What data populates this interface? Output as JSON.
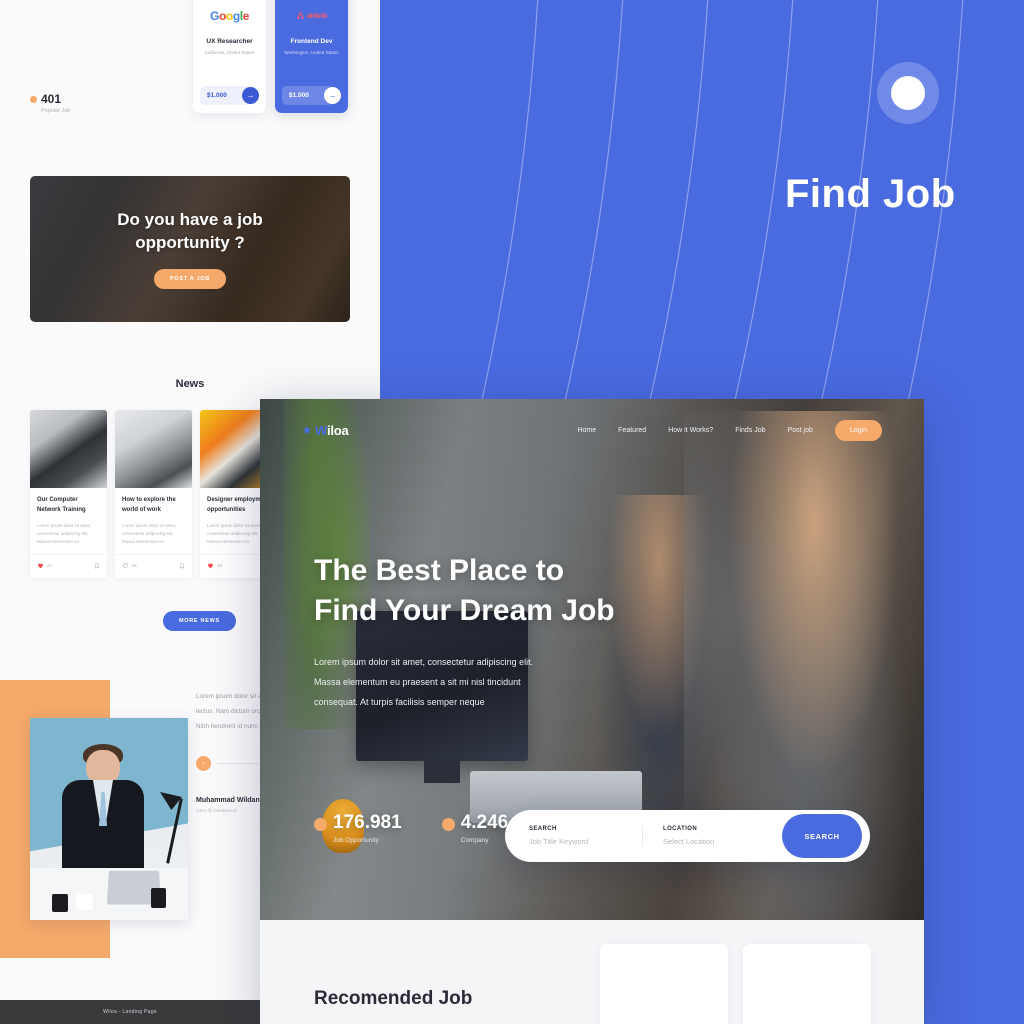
{
  "poster": {
    "title": "Find Job",
    "brand_blue": "#4a6ae0",
    "brand_orange": "#f5a96a"
  },
  "left_mock": {
    "job_cards": [
      {
        "company": "Google",
        "logo": "google-logo",
        "title": "UX Researcher",
        "location": "California, United States",
        "salary": "$1.000",
        "arrow": "→"
      },
      {
        "company": "airbnb",
        "logo": "airbnb-logo",
        "title": "Frontend Dev",
        "location": "Washington, United States",
        "salary": "$1.000",
        "arrow": "→"
      }
    ],
    "stat": {
      "value": "401",
      "label": "Popular Job"
    },
    "cta": {
      "line1": "Do you have a job",
      "line2": "opportunity ?",
      "button": "POST A JOB"
    },
    "news": {
      "heading": "News",
      "more_button": "MORE NEWS",
      "cards": [
        {
          "title": "Our Computer Network Training",
          "desc": "Lorem ipsum dolor sit amet, consectetur adipiscing elit. Massa elementum eu",
          "likes": "24",
          "liked": true
        },
        {
          "title": "How to explore the world of work",
          "desc": "Lorem ipsum dolor sit amet, consectetur adipiscing elit. Massa elementum eu",
          "likes": "51",
          "liked": false
        },
        {
          "title": "Designer employment opportunities",
          "desc": "Lorem ipsum dolor sit amet, consectetur adipiscing elit. Massa elementum eu",
          "likes": "48",
          "liked": true
        }
      ]
    },
    "testimonial": {
      "quote": "Lorem ipsum dolor sit amet, consectetur adipiscing elit. Nibh lectus. Nam dictum orci id massa dolor sit amet, consectetur. Nibh hendrerit id nunc orci iaculis a. Justo",
      "name": "Muhammad Wildan",
      "role": "CEO @ Onedoce.id"
    },
    "footer": "Wiloa - Landing Page"
  },
  "site": {
    "logo": {
      "highlight": "W",
      "rest": "iloa"
    },
    "nav": [
      {
        "label": "Home"
      },
      {
        "label": "Featured"
      },
      {
        "label": "How it Works?"
      },
      {
        "label": "Finds Job"
      },
      {
        "label": "Post job"
      }
    ],
    "login_button": "Login",
    "hero": {
      "headline_1": "The Best Place to",
      "headline_2": "Find Your Dream Job",
      "paragraph_1": "Lorem ipsum dolor sit amet, consectetur adipiscing elit.",
      "paragraph_2": "Massa elementum eu praesent a sit mi nisl tincidunt",
      "paragraph_3": "consequat. At turpis facilisis semper neque",
      "stats": [
        {
          "value": "176.981",
          "label": "Job Opportunity"
        },
        {
          "value": "4.246",
          "label": "Company"
        }
      ]
    },
    "search": {
      "search_label": "SEARCH",
      "search_placeholder": "Job Title Keyword",
      "location_label": "LOCATION",
      "location_placeholder": "Select Location",
      "button": "SEARCH"
    },
    "recommended": {
      "heading": "Recomended Job"
    }
  }
}
